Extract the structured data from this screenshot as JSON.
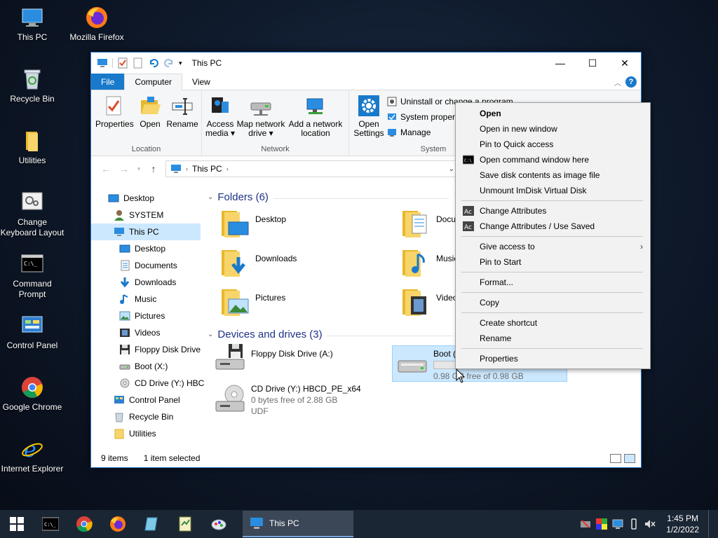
{
  "desktop": {
    "icons": [
      {
        "label": "This PC"
      },
      {
        "label": "Mozilla Firefox"
      },
      {
        "label": "Recycle Bin"
      },
      {
        "label": "Utilities"
      },
      {
        "label": "Change Keyboard Layout"
      },
      {
        "label": "Command Prompt"
      },
      {
        "label": "Control Panel"
      },
      {
        "label": "Google Chrome"
      },
      {
        "label": "Internet Explorer"
      }
    ]
  },
  "window": {
    "title": "This PC",
    "tabs": {
      "file": "File",
      "computer": "Computer",
      "view": "View"
    },
    "ribbon": {
      "location": {
        "label": "Location",
        "properties": "Properties",
        "open": "Open",
        "rename": "Rename"
      },
      "network": {
        "label": "Network",
        "access_media": "Access media",
        "map_network_drive": "Map network drive",
        "add_network_location": "Add a network location"
      },
      "system": {
        "label": "System",
        "open_settings": "Open Settings",
        "uninstall": "Uninstall or change a program",
        "system_properties": "System properties",
        "manage": "Manage"
      }
    },
    "address": {
      "path": "This PC"
    },
    "nav": [
      {
        "label": "Desktop"
      },
      {
        "label": "SYSTEM"
      },
      {
        "label": "This PC"
      },
      {
        "label": "Desktop"
      },
      {
        "label": "Documents"
      },
      {
        "label": "Downloads"
      },
      {
        "label": "Music"
      },
      {
        "label": "Pictures"
      },
      {
        "label": "Videos"
      },
      {
        "label": "Floppy Disk Drive"
      },
      {
        "label": "Boot (X:)"
      },
      {
        "label": "CD Drive (Y:) HBC"
      },
      {
        "label": "Control Panel"
      },
      {
        "label": "Recycle Bin"
      },
      {
        "label": "Utilities"
      }
    ],
    "folders_header": "Folders (6)",
    "folders": [
      {
        "label": "Desktop"
      },
      {
        "label": "Documents"
      },
      {
        "label": "Downloads"
      },
      {
        "label": "Music"
      },
      {
        "label": "Pictures"
      },
      {
        "label": "Videos"
      }
    ],
    "drives_header": "Devices and drives (3)",
    "drives": [
      {
        "label": "Floppy Disk Drive (A:)",
        "detail": "",
        "fs": ""
      },
      {
        "label": "Boot (X:)",
        "detail": "0.98 GB free of 0.98 GB",
        "fs": "",
        "used_fraction": 0.0
      },
      {
        "label": "CD Drive (Y:) HBCD_PE_x64",
        "detail": "0 bytes free of 2.88 GB",
        "fs": "UDF"
      }
    ],
    "status": {
      "count": "9 items",
      "selected": "1 item selected"
    }
  },
  "context_menu": {
    "items": [
      {
        "label": "Open"
      },
      {
        "label": "Open in new window"
      },
      {
        "label": "Pin to Quick access"
      },
      {
        "label": "Open command window here"
      },
      {
        "label": "Save disk contents as image file"
      },
      {
        "label": "Unmount ImDisk Virtual Disk"
      },
      {
        "label": "Change Attributes"
      },
      {
        "label": "Change Attributes / Use Saved"
      },
      {
        "label": "Give access to"
      },
      {
        "label": "Pin to Start"
      },
      {
        "label": "Format..."
      },
      {
        "label": "Copy"
      },
      {
        "label": "Create shortcut"
      },
      {
        "label": "Rename"
      },
      {
        "label": "Properties"
      }
    ]
  },
  "taskbar": {
    "active_app": "This PC",
    "time": "1:45 PM",
    "date": "1/2/2022"
  },
  "colors": {
    "accent": "#1979ca",
    "selection": "#cce8ff",
    "taskbar": "#1b2634"
  }
}
